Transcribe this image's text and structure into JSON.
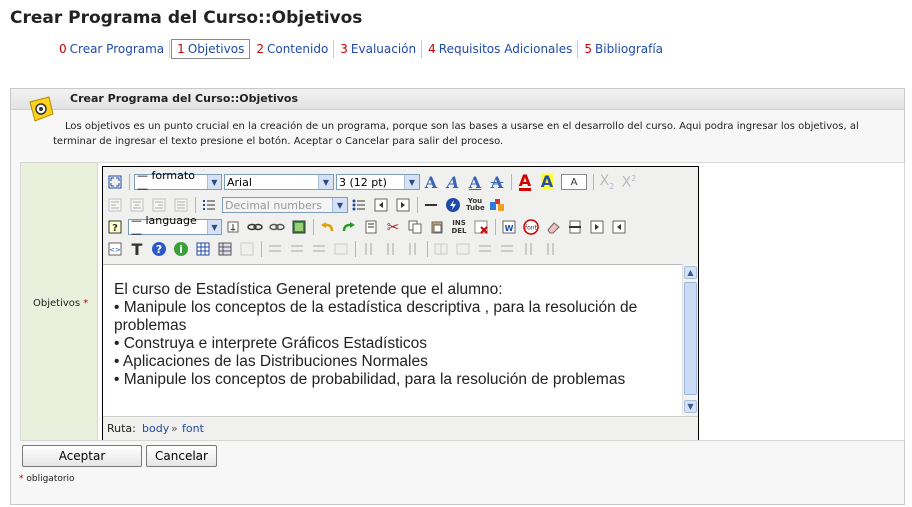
{
  "page": {
    "title": "Crear Programa del Curso::Objetivos"
  },
  "tabs": [
    {
      "num": "0",
      "label": "Crear Programa"
    },
    {
      "num": "1",
      "label": "Objetivos"
    },
    {
      "num": "2",
      "label": "Contenido"
    },
    {
      "num": "3",
      "label": "Evaluación"
    },
    {
      "num": "4",
      "label": "Requisitos Adicionales"
    },
    {
      "num": "5",
      "label": "Bibliografía"
    }
  ],
  "panel": {
    "title": "Crear Programa del Curso::Objetivos",
    "description": "Los objetivos es un punto crucial en la creación de un programa, porque son las bases a usarse en el desarrollo del curso. Aqui podra ingresar los objetivos, al terminar de ingresar el texto presione el botón. Aceptar o Cancelar para salir del proceso."
  },
  "form": {
    "label": "Objetivos",
    "required_mark": "*"
  },
  "toolbar": {
    "format_select": "— formato —",
    "font_select": "Arial",
    "size_select": "3 (12 pt)",
    "list_style_select": "Decimal numbers",
    "language_select": "— language —",
    "forecolor_letter": "A",
    "backcolor_letter": "A",
    "textbox_letter": "A",
    "youtube_label": "You Tube",
    "ins_label": "INS",
    "del_label": "DEL",
    "font_label": "font"
  },
  "editor": {
    "lines": [
      "El curso de Estadística General pretende que el alumno:",
      "• Manipule los conceptos de la estadística descriptiva , para la resolución de problemas",
      "• Construya e interprete  Gráficos Estadísticos",
      "• Aplicaciones de las Distribuciones Normales",
      "• Manipule los conceptos de probabilidad, para la resolución de problemas"
    ],
    "path_label": "Ruta:",
    "path": [
      "body",
      "font"
    ],
    "path_separator": "»"
  },
  "buttons": {
    "accept": "Aceptar",
    "cancel": "Cancelar"
  },
  "required_note": {
    "star": "*",
    "text": "obligatorio"
  }
}
